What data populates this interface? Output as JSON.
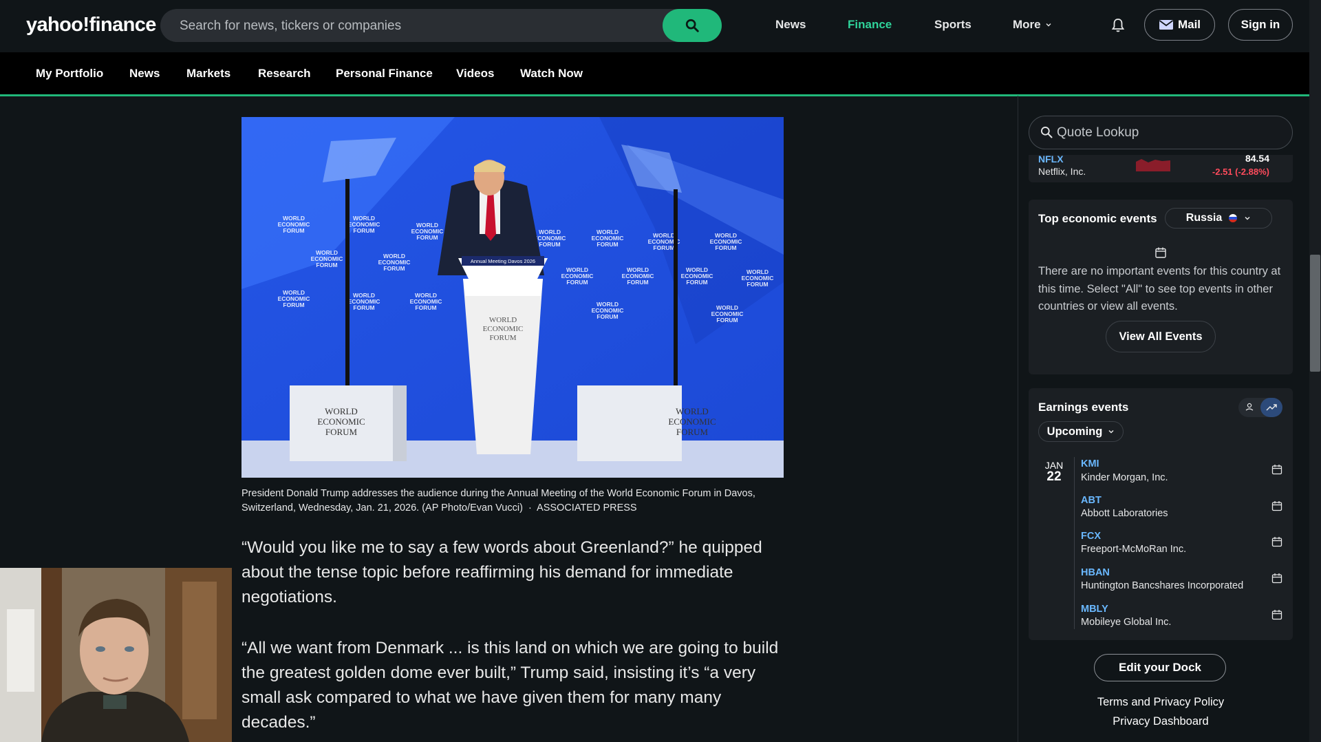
{
  "header": {
    "logo_text": "yahoo!finance",
    "search_placeholder": "Search for news, tickers or companies",
    "nav": [
      "News",
      "Finance",
      "Sports",
      "More"
    ],
    "active_nav": "Finance",
    "mail_label": "Mail",
    "signin_label": "Sign in"
  },
  "subnav": [
    "My Portfolio",
    "News",
    "Markets",
    "Research",
    "Personal Finance",
    "Videos",
    "Watch Now"
  ],
  "article": {
    "photo": {
      "podium_banner": "Annual Meeting Davos 2026",
      "logo_lines": [
        "WORLD",
        "ECONOMIC",
        "FORUM"
      ]
    },
    "caption": "President Donald Trump addresses the audience during the Annual Meeting of the World Economic Forum in Davos, Switzerland, Wednesday, Jan. 21, 2026. (AP Photo/Evan Vucci)",
    "caption_source": "ASSOCIATED PRESS",
    "caption_separator": "·",
    "paragraphs": [
      "“Would you like me to say a few words about Greenland?” he quipped about the tense topic before reaffirming his demand for immediate negotiations.",
      "“All we want from Denmark ... is this land on which we are going to build the greatest golden dome ever built,” Trump said, insisting it’s “a very small ask compared to what we have given them for many many decades.”"
    ]
  },
  "rail": {
    "quote_placeholder": "Quote Lookup",
    "watch_row": {
      "symbol": "NFLX",
      "name": "Netflix, Inc.",
      "price": "84.54",
      "change": "-2.51 (-2.88%)"
    },
    "economic_events": {
      "title": "Top economic events",
      "country": "Russia",
      "empty_text": "There are no important events for this country at this time. Select \"All\" to see top events in other countries or view all events.",
      "button": "View All Events"
    },
    "earnings": {
      "title": "Earnings events",
      "filter": "Upcoming",
      "date_month": "JAN",
      "date_day": "22",
      "rows": [
        {
          "symbol": "KMI",
          "name": "Kinder Morgan, Inc."
        },
        {
          "symbol": "ABT",
          "name": "Abbott Laboratories"
        },
        {
          "symbol": "FCX",
          "name": "Freeport-McMoRan Inc."
        },
        {
          "symbol": "HBAN",
          "name": "Huntington Bancshares Incorporated"
        },
        {
          "symbol": "MBLY",
          "name": "Mobileye Global Inc."
        }
      ]
    },
    "edit_dock": "Edit your Dock",
    "footer_links": [
      "Terms and Privacy Policy",
      "Privacy Dashboard"
    ]
  },
  "colors": {
    "accent": "#20b87a",
    "link": "#6ab8ff",
    "negative": "#ff4b5c",
    "background": "#101518"
  }
}
